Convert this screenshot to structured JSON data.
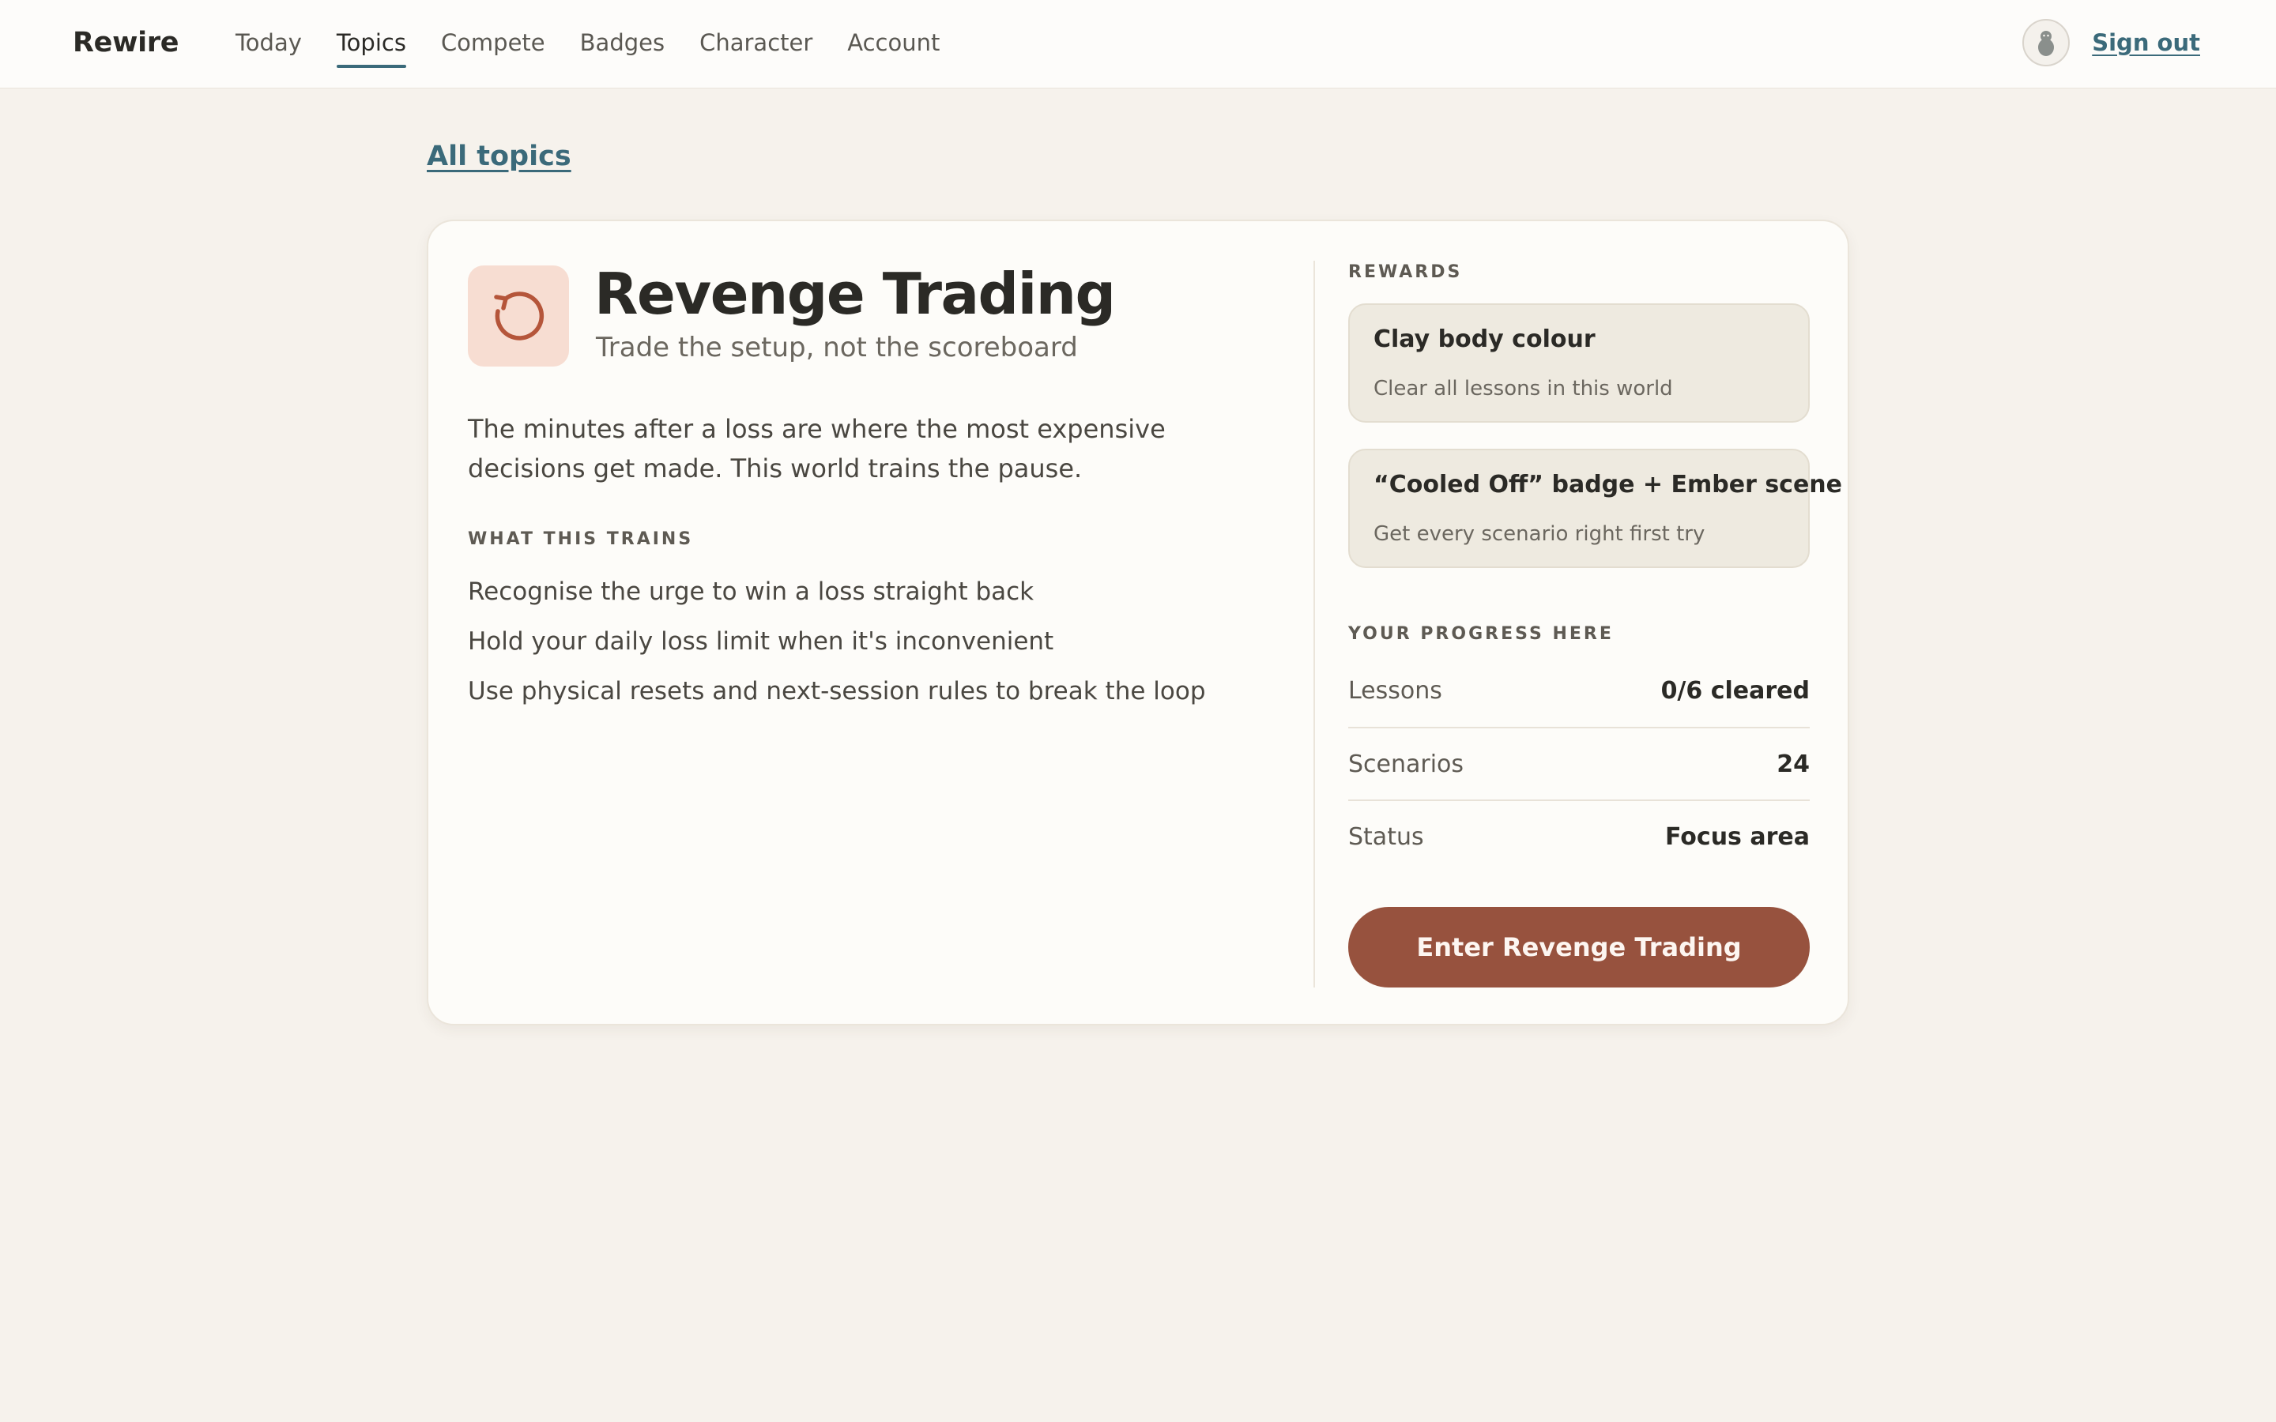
{
  "app": {
    "brand": "Rewire"
  },
  "nav": {
    "items": [
      {
        "label": "Today",
        "active": false
      },
      {
        "label": "Topics",
        "active": true
      },
      {
        "label": "Compete",
        "active": false
      },
      {
        "label": "Badges",
        "active": false
      },
      {
        "label": "Character",
        "active": false
      },
      {
        "label": "Account",
        "active": false
      }
    ],
    "avatar_icon": "character-avatar-icon",
    "signout_label": "Sign out"
  },
  "back_link": "All topics",
  "topic": {
    "icon": "rotate-ccw-icon",
    "title": "Revenge Trading",
    "subtitle": "Trade the setup, not the scoreboard",
    "description": "The minutes after a loss are where the most expensive decisions get made. This world trains the pause.",
    "trains_heading": "What this trains",
    "trains": [
      "Recognise the urge to win a loss straight back",
      "Hold your daily loss limit when it's inconvenient",
      "Use physical resets and next-session rules to break the loop"
    ]
  },
  "rewards": {
    "heading": "Rewards",
    "items": [
      {
        "title": "Clay body colour",
        "desc": "Clear all lessons in this world"
      },
      {
        "title": "“Cooled Off” badge + Ember scene",
        "desc": "Get every scenario right first try"
      }
    ]
  },
  "progress": {
    "heading": "Your progress here",
    "rows": [
      {
        "label": "Lessons",
        "value": "0/6 cleared"
      },
      {
        "label": "Scenarios",
        "value": "24"
      },
      {
        "label": "Status",
        "value": "Focus area"
      }
    ]
  },
  "cta": {
    "label": "Enter Revenge Trading"
  },
  "colors": {
    "background": "#f6f2ec",
    "accent_link": "#3b6a7a",
    "cta": "#97523e",
    "icon_bg": "#f7ddd2",
    "icon_fg": "#b5553a",
    "reward_bg": "#eeeae0"
  }
}
